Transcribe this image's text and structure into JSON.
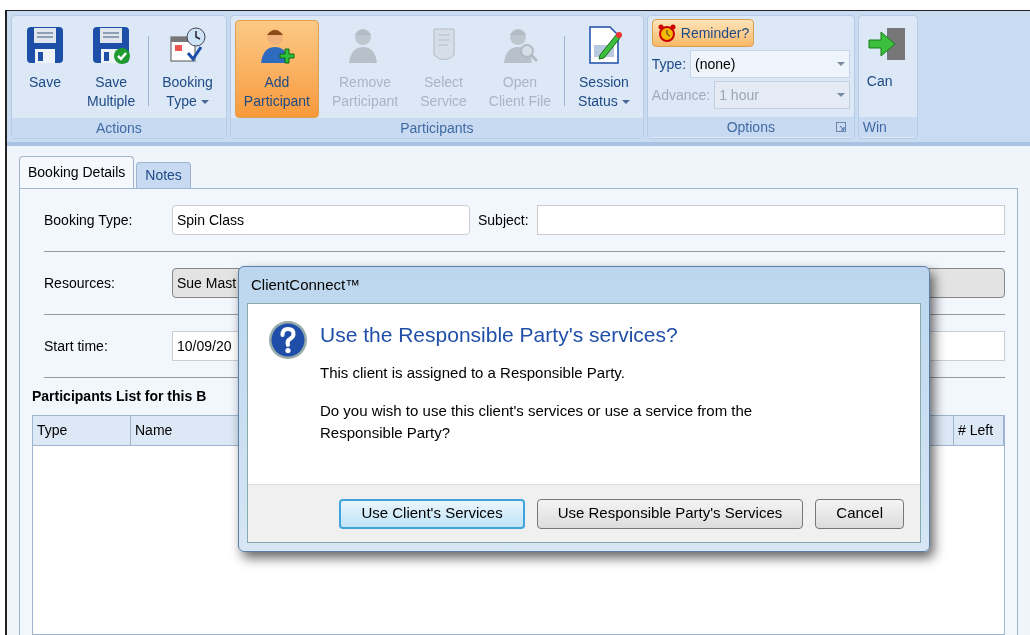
{
  "ribbon": {
    "groups": [
      {
        "label": "Actions",
        "buttons": [
          {
            "lines": [
              "Save"
            ],
            "disabled": false,
            "selected": false,
            "dropdown": false
          },
          {
            "lines": [
              "Save",
              "Multiple"
            ],
            "disabled": false,
            "selected": false,
            "dropdown": false
          },
          {
            "lines": [
              "Booking",
              "Type"
            ],
            "disabled": false,
            "selected": false,
            "dropdown": true
          }
        ]
      },
      {
        "label": "Participants",
        "buttons": [
          {
            "lines": [
              "Add",
              "Participant"
            ],
            "disabled": false,
            "selected": true,
            "dropdown": false
          },
          {
            "lines": [
              "Remove",
              "Participant"
            ],
            "disabled": true,
            "selected": false,
            "dropdown": false
          },
          {
            "lines": [
              "Select",
              "Service"
            ],
            "disabled": true,
            "selected": false,
            "dropdown": false
          },
          {
            "lines": [
              "Open",
              "Client File"
            ],
            "disabled": true,
            "selected": false,
            "dropdown": false
          },
          {
            "lines": [
              "Session",
              "Status"
            ],
            "disabled": false,
            "selected": false,
            "dropdown": true
          }
        ]
      }
    ],
    "options": {
      "label": "Options",
      "reminder": {
        "label": "Reminder?",
        "selected": true
      },
      "fields": [
        {
          "label": "Type:",
          "value": "(none)",
          "disabled": false
        },
        {
          "label": "Advance:",
          "value": "1 hour",
          "disabled": true
        }
      ]
    },
    "window_group": {
      "label": "Win",
      "button": "Can"
    }
  },
  "tabs": [
    {
      "label": "Booking Details",
      "selected": true
    },
    {
      "label": "Notes",
      "selected": false
    }
  ],
  "form": {
    "booking_type": {
      "label": "Booking Type:",
      "value": "Spin Class"
    },
    "subject": {
      "label": "Subject:"
    },
    "resources": {
      "label": "Resources:",
      "value": "Sue Mast"
    },
    "start_time": {
      "label": "Start time:",
      "value": "10/09/20"
    }
  },
  "participants": {
    "title": "Participants List for this B",
    "columns": [
      "Type",
      "Name",
      "# Left"
    ]
  },
  "dialog": {
    "title": "ClientConnect™",
    "heading": "Use the Responsible Party's services?",
    "messages": [
      "This client is assigned to a Responsible Party.",
      "Do you wish to use this client's services or use a service from the Responsible Party?"
    ],
    "buttons": [
      {
        "label": "Use Client's Services",
        "selected": true
      },
      {
        "label": "Use Responsible Party's Services",
        "selected": false
      },
      {
        "label": "Cancel",
        "selected": false
      }
    ]
  }
}
